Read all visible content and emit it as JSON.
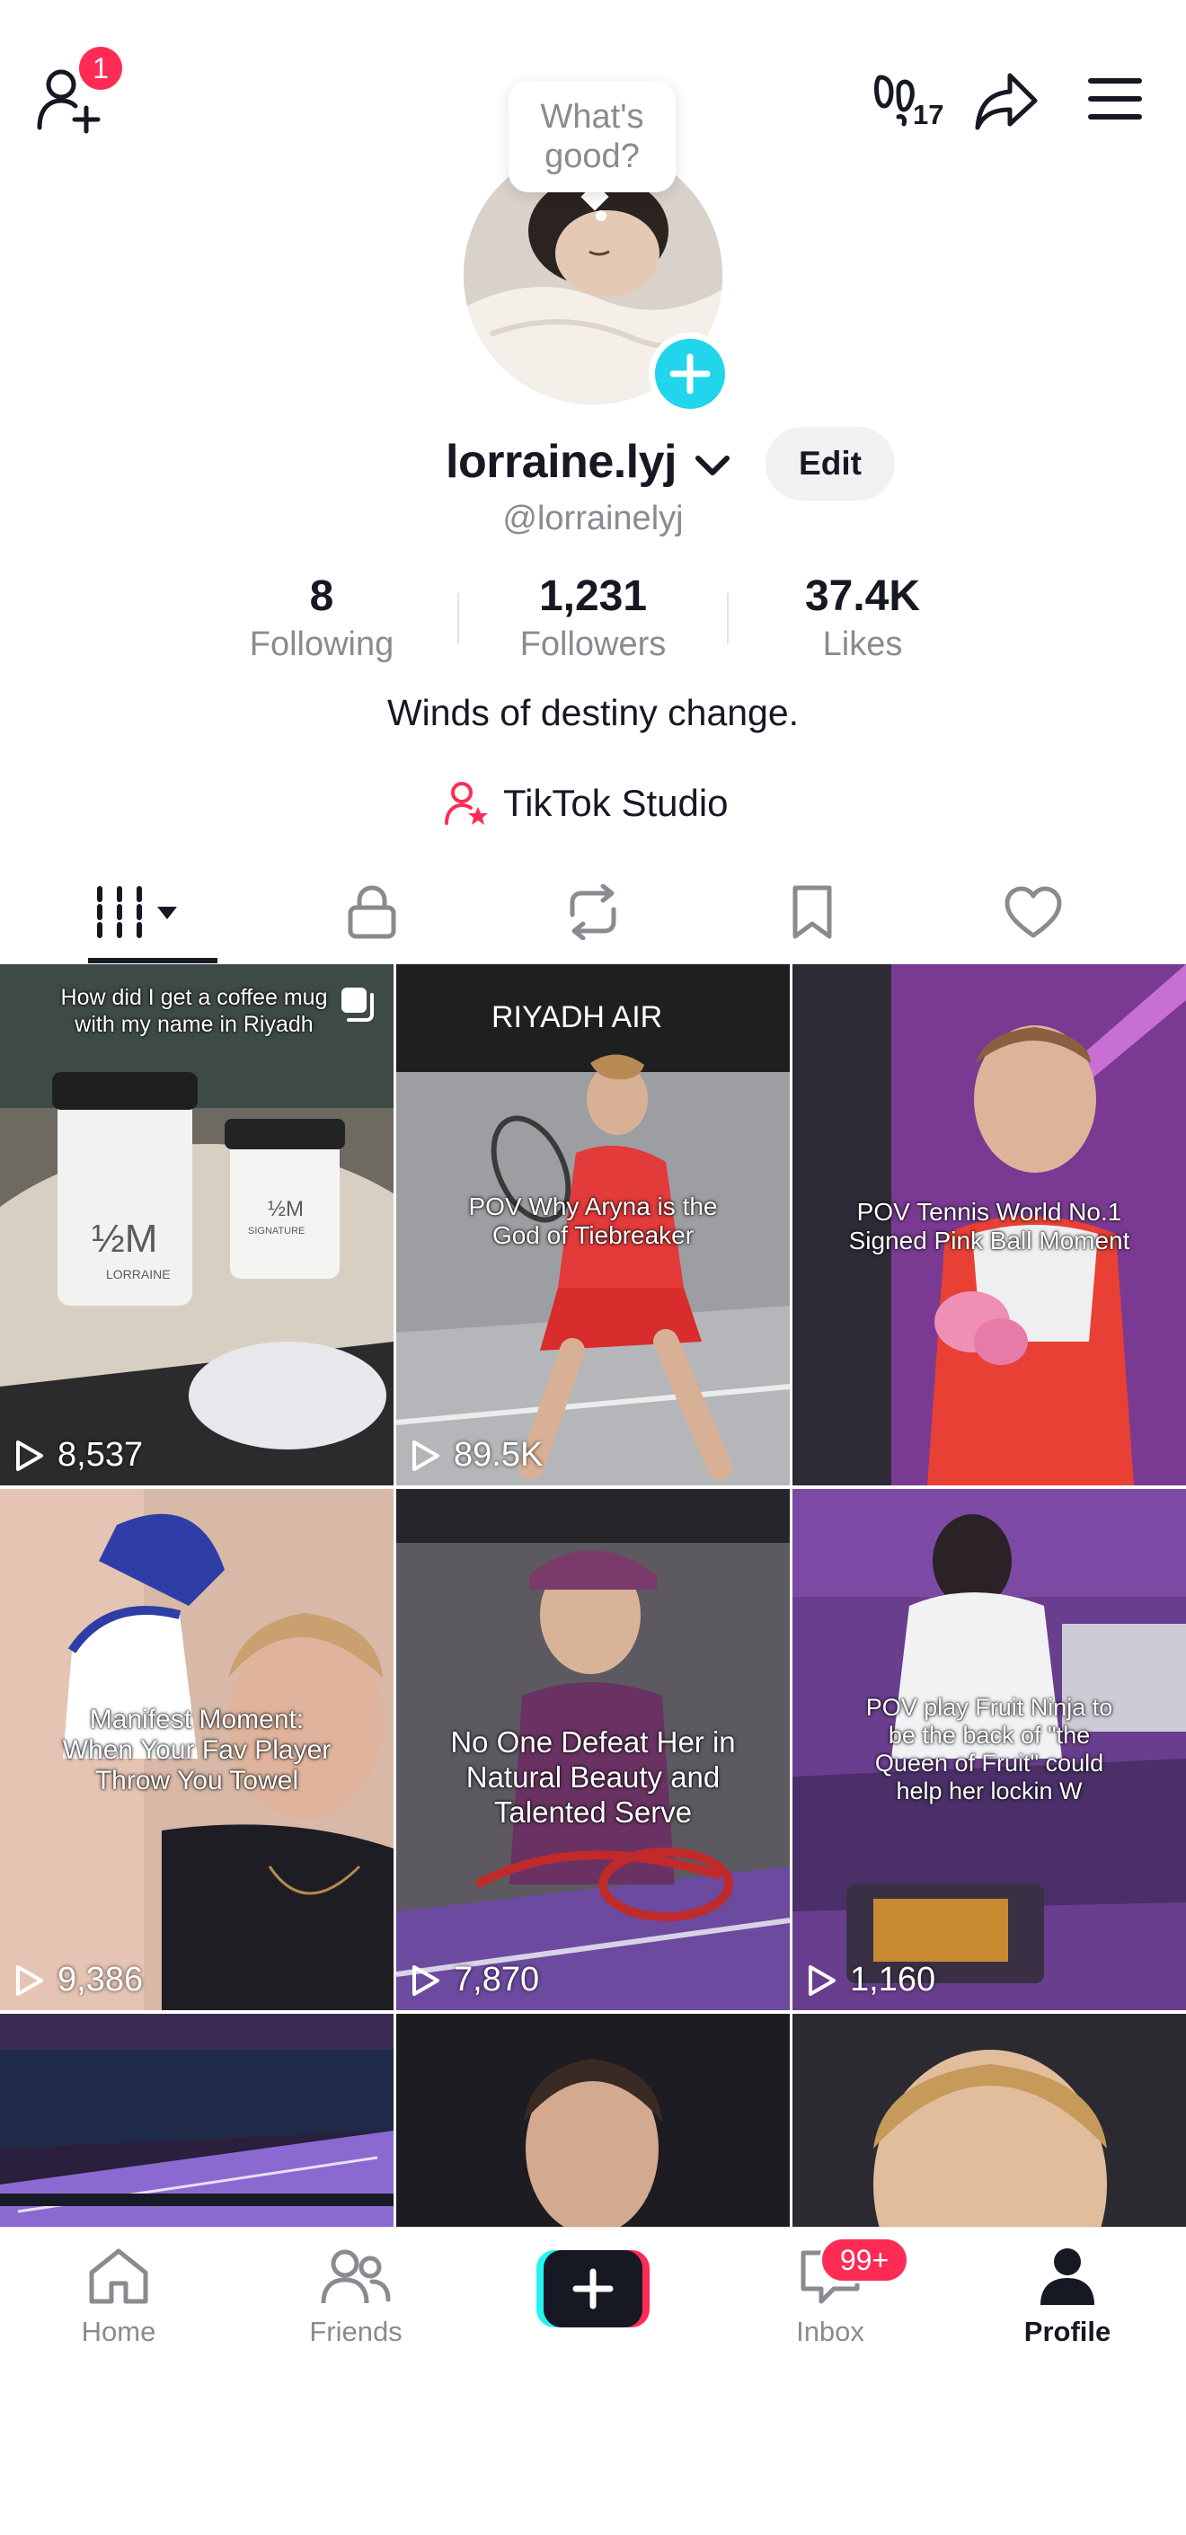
{
  "top_bar": {
    "add_friend_badge": "1",
    "username_count_label": "17",
    "bubble_text_line1": "What's",
    "bubble_text_line2": "good?"
  },
  "profile": {
    "display_name": "lorraine.lyj",
    "edit_label": "Edit",
    "handle": "@lorrainelyj",
    "bio": "Winds of destiny change.",
    "studio_label": "TikTok Studio"
  },
  "stats": [
    {
      "value": "8",
      "label": "Following"
    },
    {
      "value": "1,231",
      "label": "Followers"
    },
    {
      "value": "37.4K",
      "label": "Likes"
    }
  ],
  "tabs": [
    {
      "icon": "grid-icon",
      "active": true
    },
    {
      "icon": "lock-icon"
    },
    {
      "icon": "repost-icon"
    },
    {
      "icon": "bookmark-icon"
    },
    {
      "icon": "heart-icon"
    }
  ],
  "videos": [
    {
      "caption": "How did I get a coffee mug with my name in Riyadh",
      "views": "8,537",
      "bg_text": "RIYADH",
      "mug_text": "½M",
      "mug_name": "LORRAINE",
      "mug_text2": "½M",
      "mug_sub": "SIGNATURE"
    },
    {
      "caption": "POV Why Aryna is the God of Tiebreaker",
      "views": "89.5K",
      "bg_text": "RIYADH AIR"
    },
    {
      "caption": "POV Tennis World No.1 Signed Pink Ball Moment",
      "views": ""
    },
    {
      "caption": "Manifest Moment: When Your Fav Player Throw You Towel",
      "views": "9,386"
    },
    {
      "caption": "No One Defeat Her in Natural Beauty and Talented Serve",
      "views": "7,870"
    },
    {
      "caption": "POV play Fruit Ninja to be the back of \"the Queen of Fruit\" could help her lockin W",
      "views": "1,160"
    },
    {
      "caption": "",
      "views": ""
    },
    {
      "caption": "",
      "views": ""
    },
    {
      "caption": "",
      "views": ""
    }
  ],
  "nav": {
    "home": "Home",
    "friends": "Friends",
    "inbox": "Inbox",
    "inbox_badge": "99+",
    "profile": "Profile"
  },
  "colors": {
    "accent_red": "#fe2c55",
    "accent_cyan": "#20d5ec",
    "text_primary": "#161823",
    "text_secondary": "#8a8b91"
  }
}
